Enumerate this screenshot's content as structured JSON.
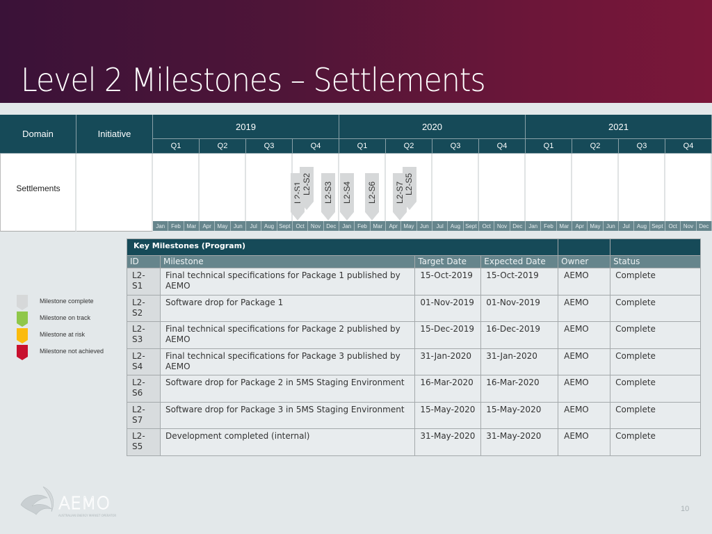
{
  "slide": {
    "title": "Level 2 Milestones – Settlements",
    "page_number": "10"
  },
  "roadmap": {
    "domain_header": "Domain",
    "initiative_header": "Initiative",
    "domain": "Settlements",
    "initiative": "",
    "years": [
      "2019",
      "2020",
      "2021"
    ],
    "quarters": [
      "Q1",
      "Q2",
      "Q3",
      "Q4"
    ],
    "months": [
      "Jan",
      "Feb",
      "Mar",
      "Apr",
      "May",
      "Jun",
      "Jul",
      "Aug",
      "Sept",
      "Oct",
      "Nov",
      "Dec"
    ],
    "markers": [
      {
        "id": "L2-S1",
        "month_index": 9.3,
        "status": "complete",
        "lane": "low"
      },
      {
        "id": "L2-S2",
        "month_index": 9.9,
        "status": "complete",
        "lane": "high"
      },
      {
        "id": "L2-S3",
        "month_index": 11.3,
        "status": "complete",
        "lane": "low"
      },
      {
        "id": "L2-S4",
        "month_index": 12.5,
        "status": "complete",
        "lane": "low"
      },
      {
        "id": "L2-S6",
        "month_index": 14.1,
        "status": "complete",
        "lane": "low"
      },
      {
        "id": "L2-S7",
        "month_index": 15.9,
        "status": "complete",
        "lane": "low"
      },
      {
        "id": "L2-S5",
        "month_index": 16.5,
        "status": "complete",
        "lane": "high"
      }
    ]
  },
  "legend": [
    {
      "label": "Milestone complete",
      "color": "#d6d8d9"
    },
    {
      "label": "Milestone on track",
      "color": "#8fc74a"
    },
    {
      "label": "Milestone at risk",
      "color": "#fbbb0d"
    },
    {
      "label": "Milestone not achieved",
      "color": "#c8102e"
    }
  ],
  "milestones": {
    "title": "Key Milestones (Program)",
    "columns": [
      "ID",
      "Milestone",
      "Target Date",
      "Expected Date",
      "Owner",
      "Status"
    ],
    "rows": [
      {
        "id": "L2-S1",
        "milestone": "Final technical specifications for Package 1 published by AEMO",
        "target": "15-Oct-2019",
        "expected": "15-Oct-2019",
        "owner": "AEMO",
        "status": "Complete"
      },
      {
        "id": "L2-S2",
        "milestone": "Software drop for Package 1",
        "target": "01-Nov-2019",
        "expected": "01-Nov-2019",
        "owner": "AEMO",
        "status": "Complete"
      },
      {
        "id": "L2-S3",
        "milestone": "Final technical specifications for Package 2 published by AEMO",
        "target": "15-Dec-2019",
        "expected": "16-Dec-2019",
        "owner": "AEMO",
        "status": "Complete"
      },
      {
        "id": "L2-S4",
        "milestone": "Final technical specifications for Package 3 published by AEMO",
        "target": "31-Jan-2020",
        "expected": "31-Jan-2020",
        "owner": "AEMO",
        "status": "Complete"
      },
      {
        "id": "L2-S6",
        "milestone": "Software drop for Package 2 in 5MS Staging Environment",
        "target": "16-Mar-2020",
        "expected": "16-Mar-2020",
        "owner": "AEMO",
        "status": "Complete"
      },
      {
        "id": "L2-S7",
        "milestone": "Software drop for Package 3 in 5MS Staging Environment",
        "target": "15-May-2020",
        "expected": "15-May-2020",
        "owner": "AEMO",
        "status": "Complete"
      },
      {
        "id": "L2-S5",
        "milestone": "Development completed (internal)",
        "target": "31-May-2020",
        "expected": "31-May-2020",
        "owner": "AEMO",
        "status": "Complete"
      }
    ]
  },
  "logo": {
    "name": "AEMO",
    "tagline": "AUSTRALIAN ENERGY MARKET OPERATOR"
  }
}
